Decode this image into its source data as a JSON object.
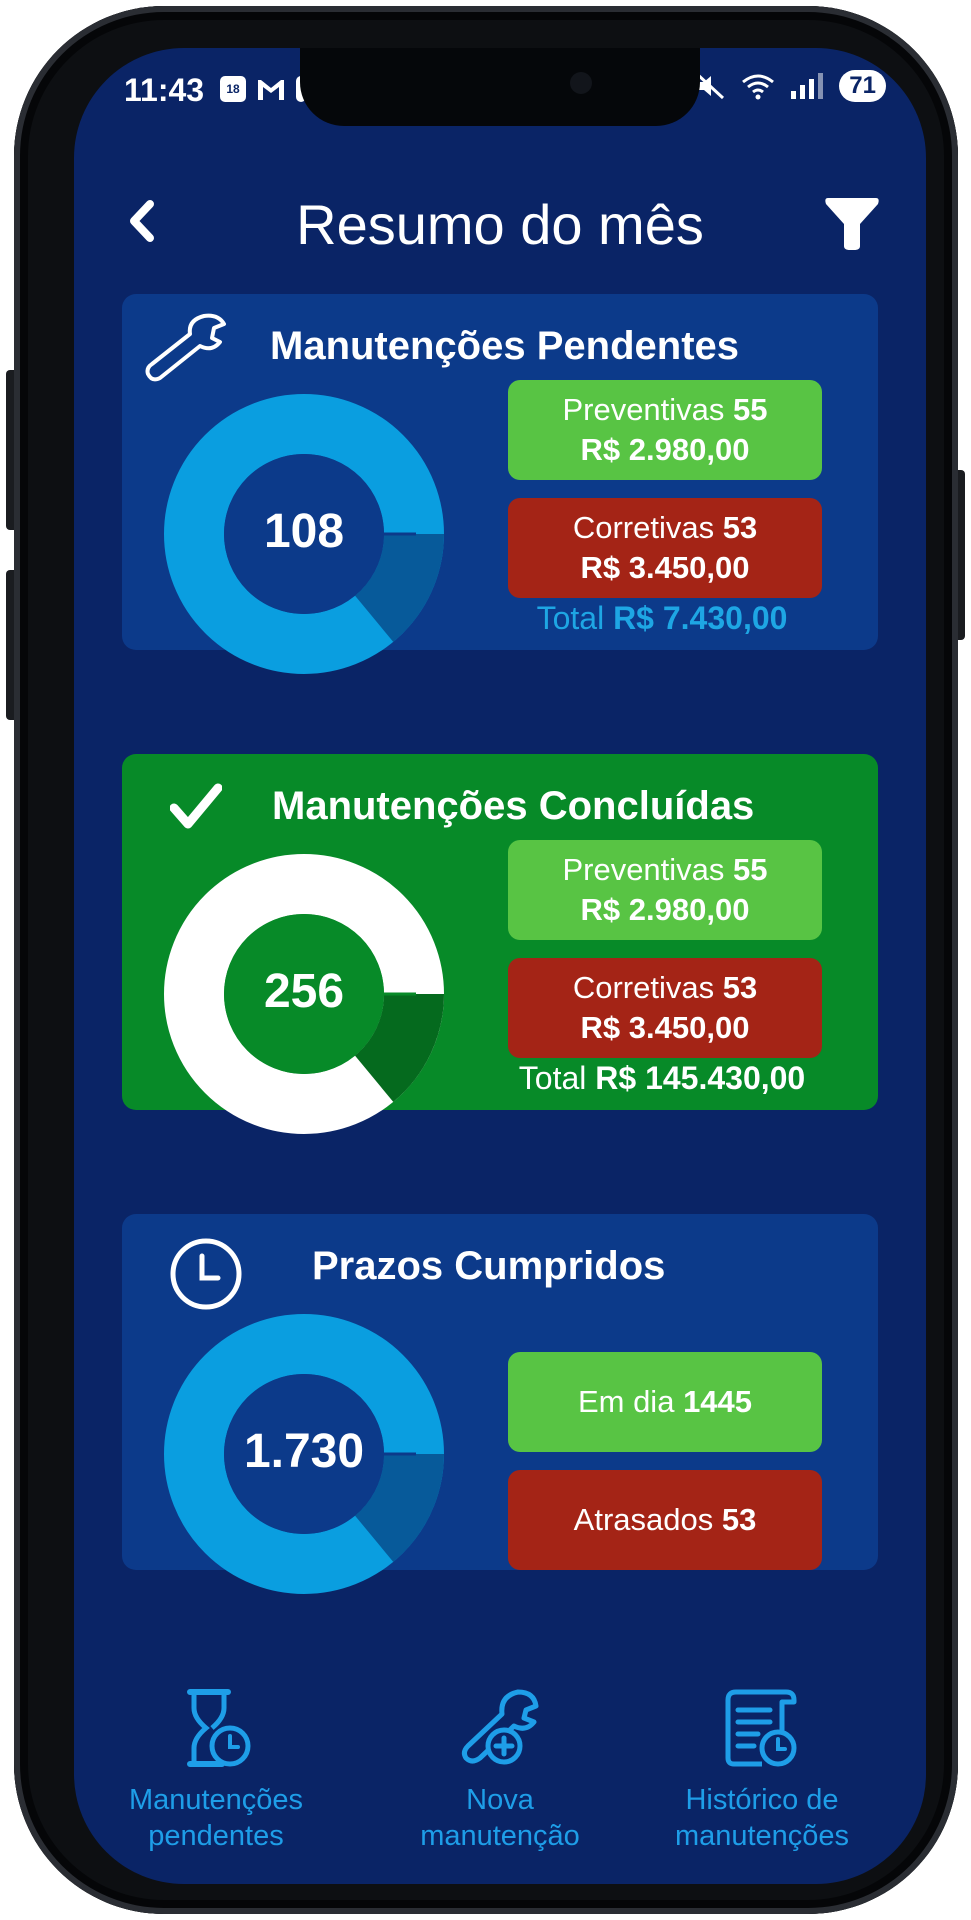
{
  "status_bar": {
    "time": "11:43",
    "calendar_day": "18",
    "battery": "71"
  },
  "header": {
    "title": "Resumo do mês"
  },
  "pending": {
    "title": "Manutenções Pendentes",
    "total_count": "108",
    "preventive_label": "Preventivas",
    "preventive_count": "55",
    "preventive_amount": "R$ 2.980,00",
    "corrective_label": "Corretivas",
    "corrective_count": "53",
    "corrective_amount": "R$ 3.450,00",
    "total_label": "Total",
    "total_amount": "R$ 7.430,00",
    "donut_major_fraction": 0.86
  },
  "completed": {
    "title": "Manutenções Concluídas",
    "total_count": "256",
    "preventive_label": "Preventivas",
    "preventive_count": "55",
    "preventive_amount": "R$ 2.980,00",
    "corrective_label": "Corretivas",
    "corrective_count": "53",
    "corrective_amount": "R$ 3.450,00",
    "total_label": "Total",
    "total_amount": "R$ 145.430,00",
    "donut_major_fraction": 0.86
  },
  "deadlines": {
    "title": "Prazos Cumpridos",
    "total_count": "1.730",
    "on_time_label": "Em dia",
    "on_time_count": "1445",
    "late_label": "Atrasados",
    "late_count": "53",
    "donut_major_fraction": 0.86
  },
  "tabbar": {
    "items": [
      {
        "label_line1": "Manutenções",
        "label_line2": "pendentes",
        "icon": "hourglass-icon"
      },
      {
        "label_line1": "Nova",
        "label_line2": "manutenção",
        "icon": "wrench-plus-icon"
      },
      {
        "label_line1": "Histórico de",
        "label_line2": "manutenções",
        "icon": "history-document-icon"
      }
    ]
  },
  "colors": {
    "background": "#0a2466",
    "card_blue": "#0c3a8a",
    "card_green": "#078a28",
    "pill_green": "#58c444",
    "pill_red": "#a42416",
    "donut_cyan": "#0a9ee0",
    "donut_cyan_dark": "#075a9a",
    "tab_blue": "#1e9ee8"
  }
}
